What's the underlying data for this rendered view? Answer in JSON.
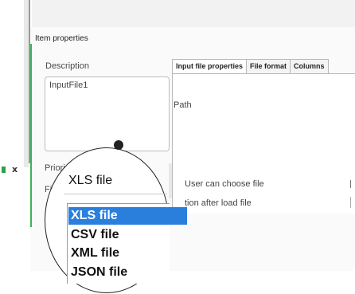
{
  "panel": {
    "title": "Item properties",
    "description_label": "Description",
    "description_value": "InputFile1",
    "priority_label": "Priori",
    "file_label": "Fi"
  },
  "tabs": [
    {
      "label": "Input file properties",
      "active": true
    },
    {
      "label": "File format",
      "active": false
    },
    {
      "label": "Columns",
      "active": false
    }
  ],
  "tab_content": {
    "path_label": "Path",
    "user_can_choose_label": "User can choose file",
    "action_after_load_label": "tion after load file"
  },
  "toolbar": {
    "close_glyph": "x"
  },
  "file_type_select": {
    "selected": "XLS file",
    "options": [
      "XLS file",
      "CSV file",
      "XML file",
      "JSON file"
    ],
    "highlighted_index": 0
  },
  "colors": {
    "accent_green": "#3db15a",
    "selection_blue": "#2b7fdc"
  },
  "icons": [
    "close-icon",
    "status-green-icon"
  ]
}
